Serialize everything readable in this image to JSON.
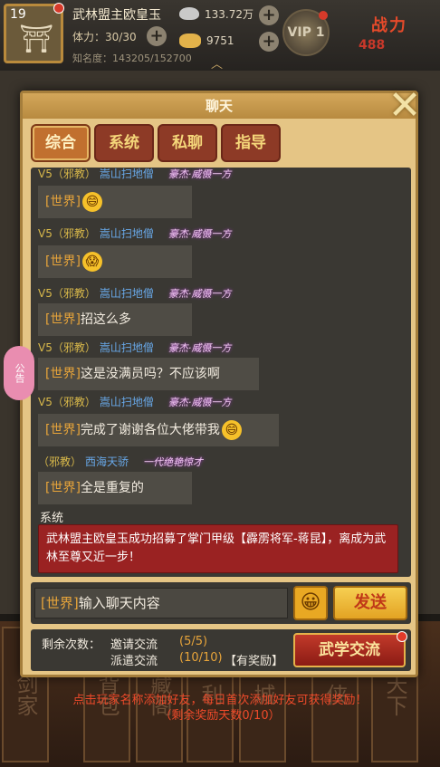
{
  "player": {
    "level": "19",
    "name": "武林盟主欧皇玉",
    "stamina": "体力：30/30",
    "fame": "知名度：143205/152700",
    "silver": "133.72万",
    "gold": "9751",
    "vip": "VIP 1",
    "power_label": "战力",
    "power_value": "488"
  },
  "background_menu": [
    "剑家",
    "背包",
    "藏阁",
    "利",
    "城",
    "侠",
    "天下"
  ],
  "notice_label": "公告",
  "chat": {
    "title": "聊天",
    "tabs": [
      "综合",
      "系统",
      "私聊",
      "指导"
    ],
    "messages": [
      {
        "prefix": "V5（邪教）",
        "sender": "嵩山扫地僧",
        "tag": "豪杰·威慑一方",
        "channel": "[世界]",
        "text": "",
        "emoji": "😄"
      },
      {
        "prefix": "V5（邪教）",
        "sender": "嵩山扫地僧",
        "tag": "豪杰·威慑一方",
        "channel": "[世界]",
        "text": "",
        "emoji": "😱"
      },
      {
        "prefix": "V5（邪教）",
        "sender": "嵩山扫地僧",
        "tag": "豪杰·威慑一方",
        "channel": "[世界]",
        "text": "招这么多",
        "emoji": ""
      },
      {
        "prefix": "V5（邪教）",
        "sender": "嵩山扫地僧",
        "tag": "豪杰·威慑一方",
        "channel": "[世界]",
        "text": "这是没满员吗？不应该啊",
        "emoji": ""
      },
      {
        "prefix": "V5（邪教）",
        "sender": "嵩山扫地僧",
        "tag": "豪杰·威慑一方",
        "channel": "[世界]",
        "text": "完成了谢谢各位大佬带我",
        "emoji": "😄"
      },
      {
        "prefix": "（邪教）",
        "sender": "西海天骄",
        "tag": "一代绝艳惊才",
        "channel": "[世界]",
        "text": "全是重复的",
        "emoji": ""
      }
    ],
    "system_label": "系统",
    "system_message": "武林盟主欧皇玉成功招募了掌门甲级【霹雳将军-蒋昆】，离成为武林至尊又近一步！",
    "input_channel": "[世界]",
    "input_placeholder": "输入聊天内容",
    "emoji_button": "😀",
    "send_button": "发送",
    "remaining_label": "剩余次数：",
    "invite_label": "邀请交流",
    "invite_count": "(5/5)",
    "dispatch_label": "派遣交流",
    "dispatch_count": "(10/10)",
    "dispatch_reward": "【有奖励】",
    "martial_button": "武学交流"
  },
  "tip": {
    "line1": "点击玩家名称添加好友，每日首次添加好友可获得奖励！",
    "line2": "（剩余奖励天数0/10）"
  }
}
